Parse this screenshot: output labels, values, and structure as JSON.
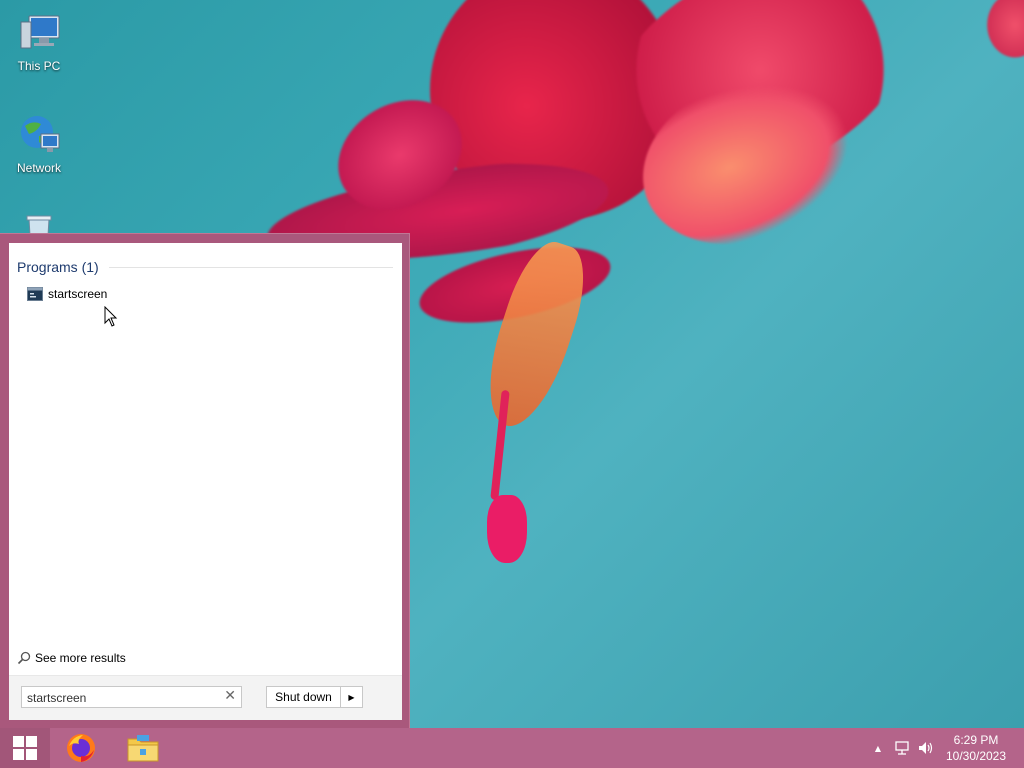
{
  "desktop": {
    "icons": [
      {
        "label": "This PC",
        "icon": "this-pc-icon"
      },
      {
        "label": "Network",
        "icon": "network-icon"
      },
      {
        "label": "",
        "icon": "recycle-bin-icon"
      }
    ]
  },
  "start_menu": {
    "programs_header": "Programs (1)",
    "results": [
      {
        "label": "startscreen",
        "icon": "program-icon"
      }
    ],
    "see_more_label": "See more results",
    "search": {
      "value": "startscreen",
      "clear_glyph": "✕"
    },
    "shutdown_label": "Shut down",
    "shutdown_arrow": "▶"
  },
  "taskbar": {
    "start_icon": "windows-logo-icon",
    "pinned": [
      {
        "name": "firefox",
        "icon": "firefox-icon"
      },
      {
        "name": "file-explorer",
        "icon": "file-explorer-icon"
      }
    ],
    "tray": {
      "overflow_glyph": "▲",
      "network_icon": "network-tray-icon",
      "volume_icon": "volume-icon"
    },
    "clock": {
      "time": "6:29 PM",
      "date": "10/30/2023"
    }
  },
  "colors": {
    "accent": "#b4648a",
    "start_menu_frame": "#a9587c",
    "header_text": "#1e3b6e"
  }
}
